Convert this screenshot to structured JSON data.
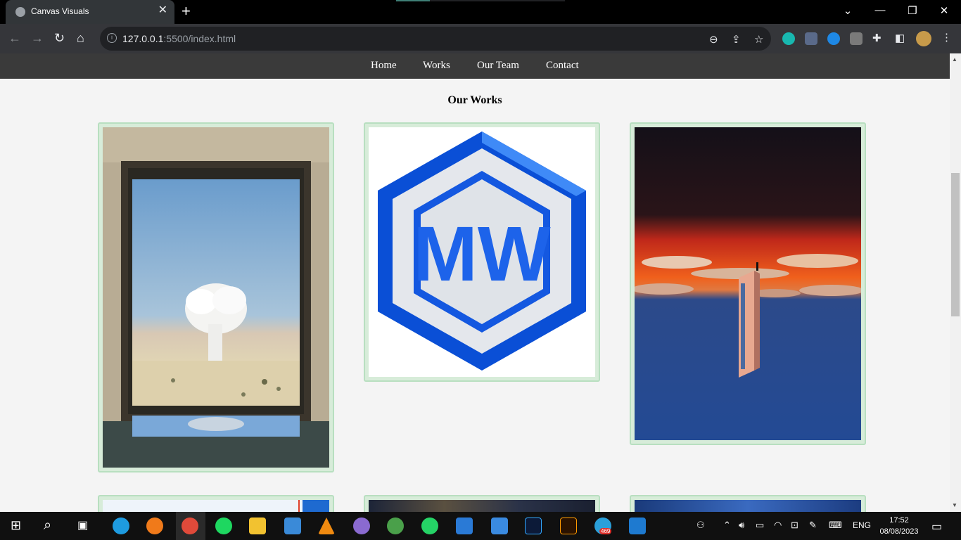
{
  "browser": {
    "tab_title": "Canvas Visuals",
    "new_tab_symbol": "+",
    "url_host": "127.0.0.1",
    "url_rest": ":5500/index.html"
  },
  "site": {
    "nav": [
      "Home",
      "Works",
      "Our Team",
      "Contact"
    ],
    "section_title": "Our Works"
  },
  "works": [
    {
      "id": "work-window-cloud",
      "description_icon": "painting"
    },
    {
      "id": "work-mw-logo",
      "logo_text": "MW"
    },
    {
      "id": "work-monolith",
      "description_icon": "painting"
    }
  ],
  "taskbar": {
    "language": "ENG",
    "time": "17:52",
    "date": "08/08/2023",
    "telegram_badge": "469"
  },
  "colors": {
    "card_border": "#b8dfc0",
    "nav_bg": "#3a3a3a",
    "page_bg": "#f4f4f4"
  }
}
